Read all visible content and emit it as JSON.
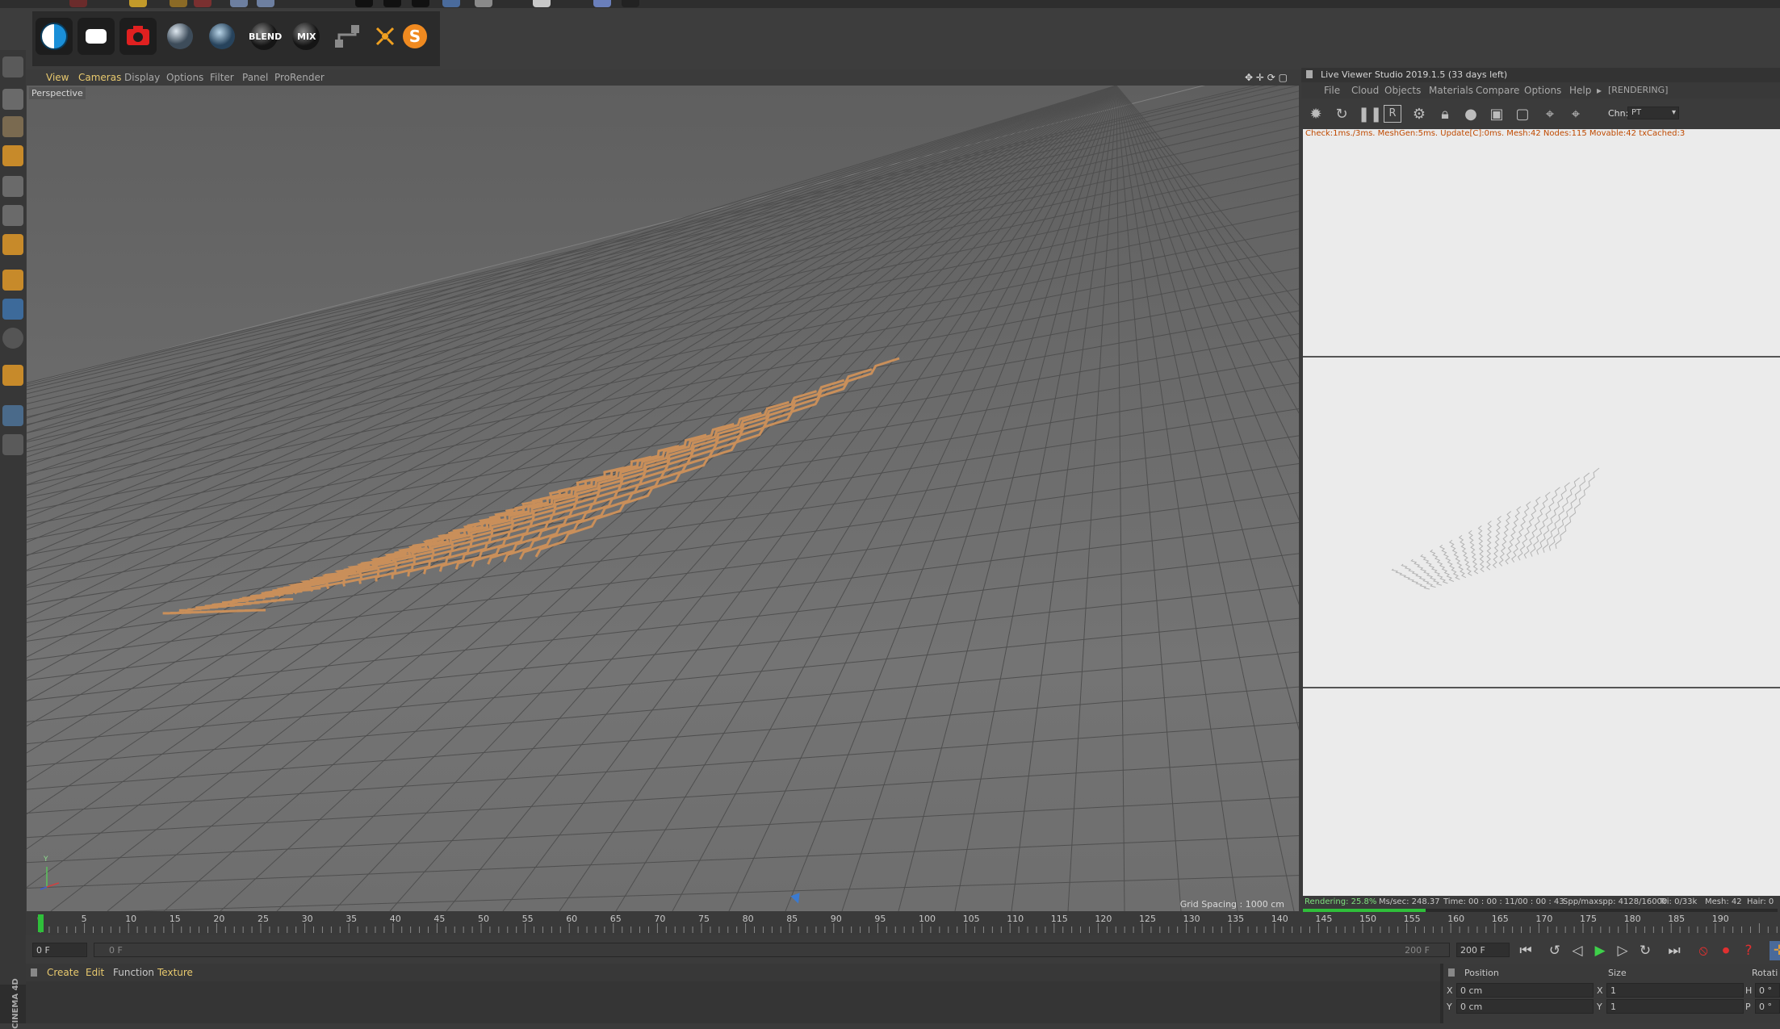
{
  "app": {
    "brand": "CINEMA 4D"
  },
  "toolbar": {
    "blend_label": "BLEND",
    "mix_label": "MIX",
    "s_label": "S"
  },
  "viewport": {
    "menu": [
      "View",
      "Cameras",
      "Display",
      "Options",
      "Filter",
      "Panel",
      "ProRender"
    ],
    "camera_label": "Perspective",
    "grid_spacing": "Grid Spacing : 1000 cm",
    "axis_y": "Y"
  },
  "live_viewer": {
    "title": "Live Viewer Studio 2019.1.5 (33 days left)",
    "menu": [
      "File",
      "Cloud",
      "Objects",
      "Materials",
      "Compare",
      "Options",
      "Help"
    ],
    "state": "[RENDERING]",
    "chn_label": "Chn:",
    "chn_value": "PT",
    "check_line": "Check:1ms./3ms. MeshGen:5ms. Update[C]:0ms. Mesh:42 Nodes:115 Movable:42 txCached:3",
    "status": {
      "rendering": "Rendering: 25.8%",
      "ms_sec": "Ms/sec: 248.37",
      "time": "Time: 00 : 00 : 11/00 : 00 : 43",
      "spp": "Spp/maxspp: 4128/16000",
      "tri": "Tri: 0/33k",
      "mesh": "Mesh: 42",
      "hair": "Hair: 0"
    },
    "progress": 0.258
  },
  "timeline": {
    "ticks": [
      "0",
      "5",
      "10",
      "15",
      "20",
      "25",
      "30",
      "35",
      "40",
      "45",
      "50",
      "55",
      "60",
      "65",
      "70",
      "75",
      "80",
      "85",
      "90",
      "95",
      "100",
      "105",
      "110",
      "115",
      "120",
      "125",
      "130",
      "135",
      "140",
      "145",
      "150",
      "155",
      "160",
      "165",
      "170",
      "175",
      "180",
      "185",
      "190"
    ],
    "current_frame": "0 F",
    "range_start": "0 F",
    "range_end": "200 F",
    "max_frame": "200 F"
  },
  "material_manager": {
    "menu": [
      "Create",
      "Edit",
      "Function",
      "Texture"
    ]
  },
  "coordinates": {
    "headers": {
      "position": "Position",
      "size": "Size",
      "rotation": "Rotati"
    },
    "rows": [
      {
        "axis": "X",
        "pos": "0 cm",
        "size_axis": "X",
        "size": "1",
        "rot_axis": "H",
        "rot": "0 °"
      },
      {
        "axis": "Y",
        "pos": "0 cm",
        "size_axis": "Y",
        "size": "1",
        "rot_axis": "P",
        "rot": "0 °"
      }
    ]
  },
  "colors": {
    "accent_orange": "#e8a037",
    "menu_yellow": "#e8c96e",
    "progress_green": "#2fbf3a",
    "warning_text": "#c04a00"
  }
}
